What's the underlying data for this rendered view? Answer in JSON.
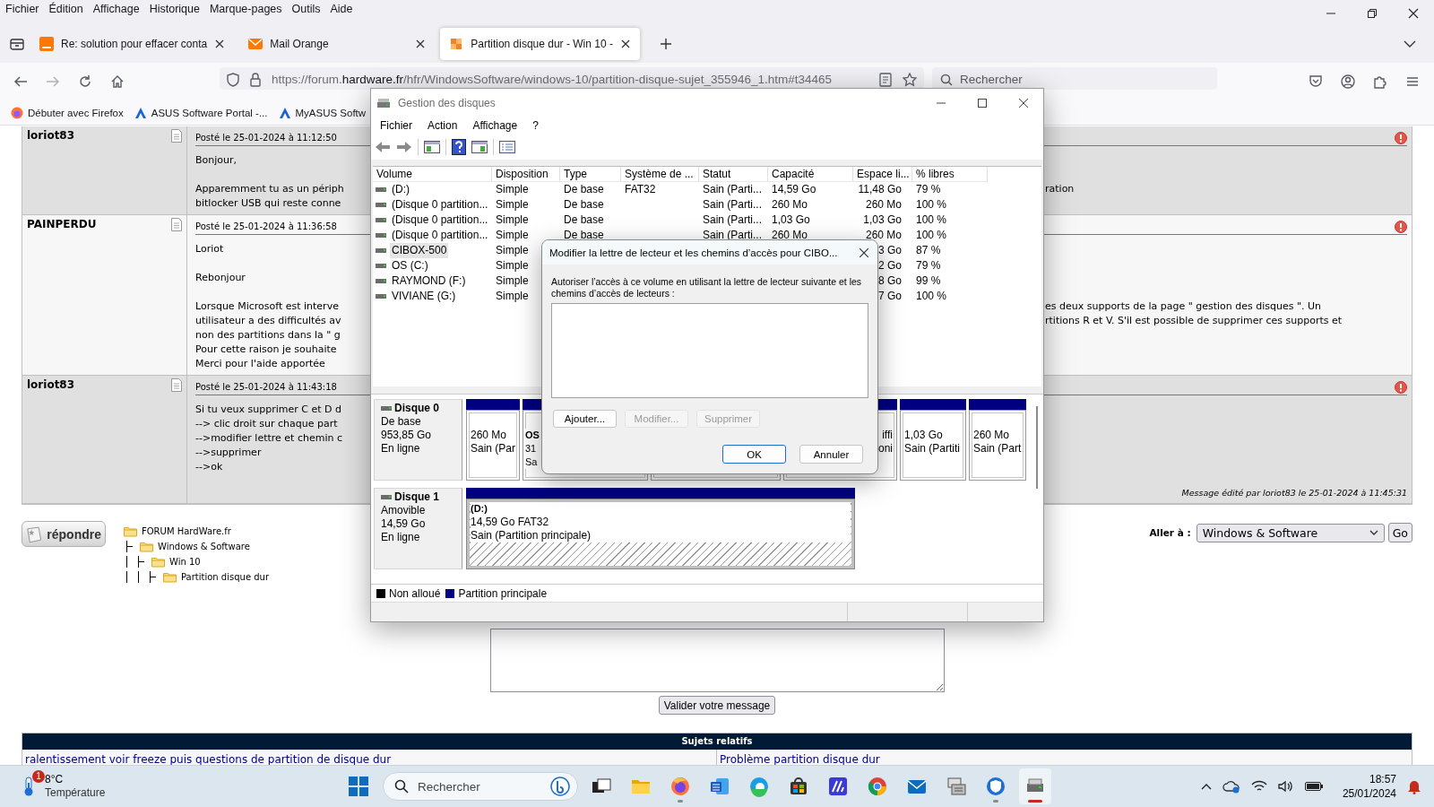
{
  "browser_menu": [
    "Fichier",
    "Édition",
    "Affichage",
    "Historique",
    "Marque-pages",
    "Outils",
    "Aide"
  ],
  "tabs": [
    {
      "label": "Re: solution pour effacer conta",
      "selected": false
    },
    {
      "label": "Mail Orange",
      "selected": false
    },
    {
      "label": "Partition disque dur - Win 10 -",
      "selected": true
    }
  ],
  "address_bar": {
    "url": "https://forum.**hardware.fr**/hfr/WindowsSoftware/windows-10/partition-disque-sujet_355946_1.htm#t34465"
  },
  "search": {
    "placeholder": "Rechercher"
  },
  "bookmarks": [
    "Débuter avec Firefox",
    "ASUS Software Portal -...",
    "MyASUS Softw"
  ],
  "posts": [
    {
      "author": "loriot83",
      "posted": "Posté le 25-01-2024 à 11:12:50",
      "paragraphs": [
        [
          {
            "left": "Bonjour,"
          }
        ],
        [
          {
            "left": "Apparemment tu as un périph",
            "right": "ration"
          },
          {
            "left": "bitlocker USB qui reste conne"
          }
        ]
      ]
    },
    {
      "author": "PAINPERDU",
      "posted": "Posté le 25-01-2024 à 11:36:58",
      "paragraphs": [
        [
          {
            "left": "Loriot"
          }
        ],
        [
          {
            "left": "Rebonjour"
          }
        ],
        [
          {
            "left": "Lorsque Microsoft est interve",
            "right": "es deux supports de la page \" gestion des disques \". Un"
          },
          {
            "left": "utilisateur a des difficultés av",
            "right": "rtitions R et V. S'il est possible de supprimer ces supports et"
          },
          {
            "left": "non des partitions dans la \" g"
          },
          {
            "left": "Pour cette raison je souhaite"
          },
          {
            "left": "Merci pour l'aide apportée"
          }
        ]
      ]
    },
    {
      "author": "loriot83",
      "posted": "Posté le 25-01-2024 à 11:43:18",
      "paragraphs": [
        [
          {
            "left": "Si tu veux supprimer C et D d"
          },
          {
            "left": "--> clic droit sur chaque part"
          },
          {
            "left": "-->modifier lettre et chemin c"
          },
          {
            "left": "-->supprimer"
          },
          {
            "left": "-->ok"
          }
        ]
      ],
      "edit_note": "Message édité par loriot83 le 25-01-2024 à 11:45:31"
    }
  ],
  "reply_button": "répondre",
  "breadcrumb": {
    "label": "FORUM HardWare.fr",
    "children": [
      {
        "label": "Windows & Software",
        "children": [
          {
            "label": "Win 10",
            "children": [
              {
                "label": "Partition disque dur"
              }
            ]
          }
        ]
      }
    ]
  },
  "jump": {
    "label": "Aller à :",
    "value": "Windows & Software",
    "button": "Go"
  },
  "submit_button": "Valider votre message",
  "related": {
    "title": "Sujets relatifs",
    "links": [
      "ralentissement voir freeze puis questions de partition de disque dur",
      "Problème partition disque dur"
    ]
  },
  "disk_window": {
    "title": "Gestion des disques",
    "menu": [
      "Fichier",
      "Action",
      "Affichage",
      "?"
    ],
    "columns": [
      "Volume",
      "Disposition",
      "Type",
      "Système de ...",
      "Statut",
      "Capacité",
      "Espace li...",
      "% libres"
    ],
    "rows": [
      {
        "volume": "(D:)",
        "disposition": "Simple",
        "type": "De base",
        "file_system": "FAT32",
        "status": "Sain (Parti...",
        "capacity": "14,59 Go",
        "free_space": "11,48 Go",
        "percent_free": "79 %",
        "selected": false
      },
      {
        "volume": "(Disque 0 partition...",
        "disposition": "Simple",
        "type": "De base",
        "status": "Sain (Parti...",
        "capacity": "260 Mo",
        "free_space": "260 Mo",
        "percent_free": "100 %",
        "selected": false
      },
      {
        "volume": "(Disque 0 partition...",
        "disposition": "Simple",
        "type": "De base",
        "status": "Sain (Parti...",
        "capacity": "1,03 Go",
        "free_space": "1,03 Go",
        "percent_free": "100 %",
        "selected": false
      },
      {
        "volume": "(Disque 0 partition...",
        "disposition": "Simple",
        "type": "De base",
        "status": "Sain (Parti...",
        "capacity": "260 Mo",
        "free_space": "260 Mo",
        "percent_free": "100 %",
        "selected": false
      },
      {
        "volume": "CIBOX-500",
        "disposition": "Simple",
        "free_space": "3 Go",
        "percent_free": "87 %",
        "selected": true
      },
      {
        "volume": "OS (C:)",
        "disposition": "Simple",
        "free_space": "2 Go",
        "percent_free": "79 %",
        "selected": false
      },
      {
        "volume": "RAYMOND  (F:)",
        "disposition": "Simple",
        "free_space": "8 Go",
        "percent_free": "99 %",
        "selected": false
      },
      {
        "volume": "VIVIANE (G:)",
        "disposition": "Simple",
        "free_space": "7 Go",
        "percent_free": "100 %",
        "selected": false
      }
    ],
    "disks": [
      {
        "name": "Disque 0",
        "type": "De base",
        "size": "953,85 Go",
        "status": "En ligne",
        "partitions": [
          {
            "kind": "primary",
            "selected": false,
            "lines": [
              "260 Mo",
              "Sain (Par"
            ]
          },
          {
            "kind": "primary",
            "selected": false,
            "name": "OS",
            "lines": [
              "31",
              "Sa"
            ]
          },
          {
            "selected": false
          },
          {
            "kind": "primary",
            "selected": false,
            "lines": [
              "iffi",
              "oni"
            ]
          },
          {
            "kind": "primary",
            "selected": false,
            "lines": [
              "1,03 Go",
              "Sain (Partiti"
            ]
          },
          {
            "kind": "primary",
            "selected": false,
            "lines": [
              "260 Mo",
              "Sain (Part"
            ]
          }
        ]
      },
      {
        "name": "Disque 1",
        "type": "Amovible",
        "size": "14,59 Go",
        "status": "En ligne",
        "partitions": [
          {
            "kind": "primary",
            "selected": true,
            "name": "(D:)",
            "lines": [
              "14,59 Go FAT32",
              "Sain (Partition principale)"
            ]
          }
        ]
      }
    ],
    "legend": [
      {
        "label": "Non alloué",
        "color": "#000000"
      },
      {
        "label": "Partition principale",
        "color": "#000080"
      }
    ]
  },
  "dialog": {
    "title": "Modifier la lettre de lecteur et les chemins d’accès pour CIBO...",
    "description": "Autoriser l’accès à ce volume en utilisant la lettre de lecteur suivante et les chemins d’accès de lecteurs :",
    "actions": [
      {
        "label": "Ajouter...",
        "disabled": false
      },
      {
        "label": "Modifier...",
        "disabled": true
      },
      {
        "label": "Supprimer",
        "disabled": true
      }
    ],
    "buttons": [
      {
        "label": "OK",
        "default": true
      },
      {
        "label": "Annuler",
        "default": false
      }
    ]
  },
  "taskbar": {
    "weather": {
      "temperature": "8°C",
      "label": "Température",
      "badge": "1"
    },
    "search": {
      "placeholder": "Rechercher"
    },
    "apps": [
      {
        "running": false,
        "selected": false
      },
      {
        "running": false,
        "selected": false
      },
      {
        "running": true,
        "selected": false
      },
      {
        "running": false,
        "selected": false
      },
      {
        "running": false,
        "selected": false
      },
      {
        "running": false,
        "selected": false
      },
      {
        "running": false,
        "selected": false
      },
      {
        "running": false,
        "selected": false
      },
      {
        "running": false,
        "selected": false
      },
      {
        "running": false,
        "selected": false
      },
      {
        "running": true,
        "selected": false
      },
      {
        "running": true,
        "selected": true
      }
    ],
    "clock": {
      "time": "18:57",
      "date": "25/01/2024"
    }
  }
}
